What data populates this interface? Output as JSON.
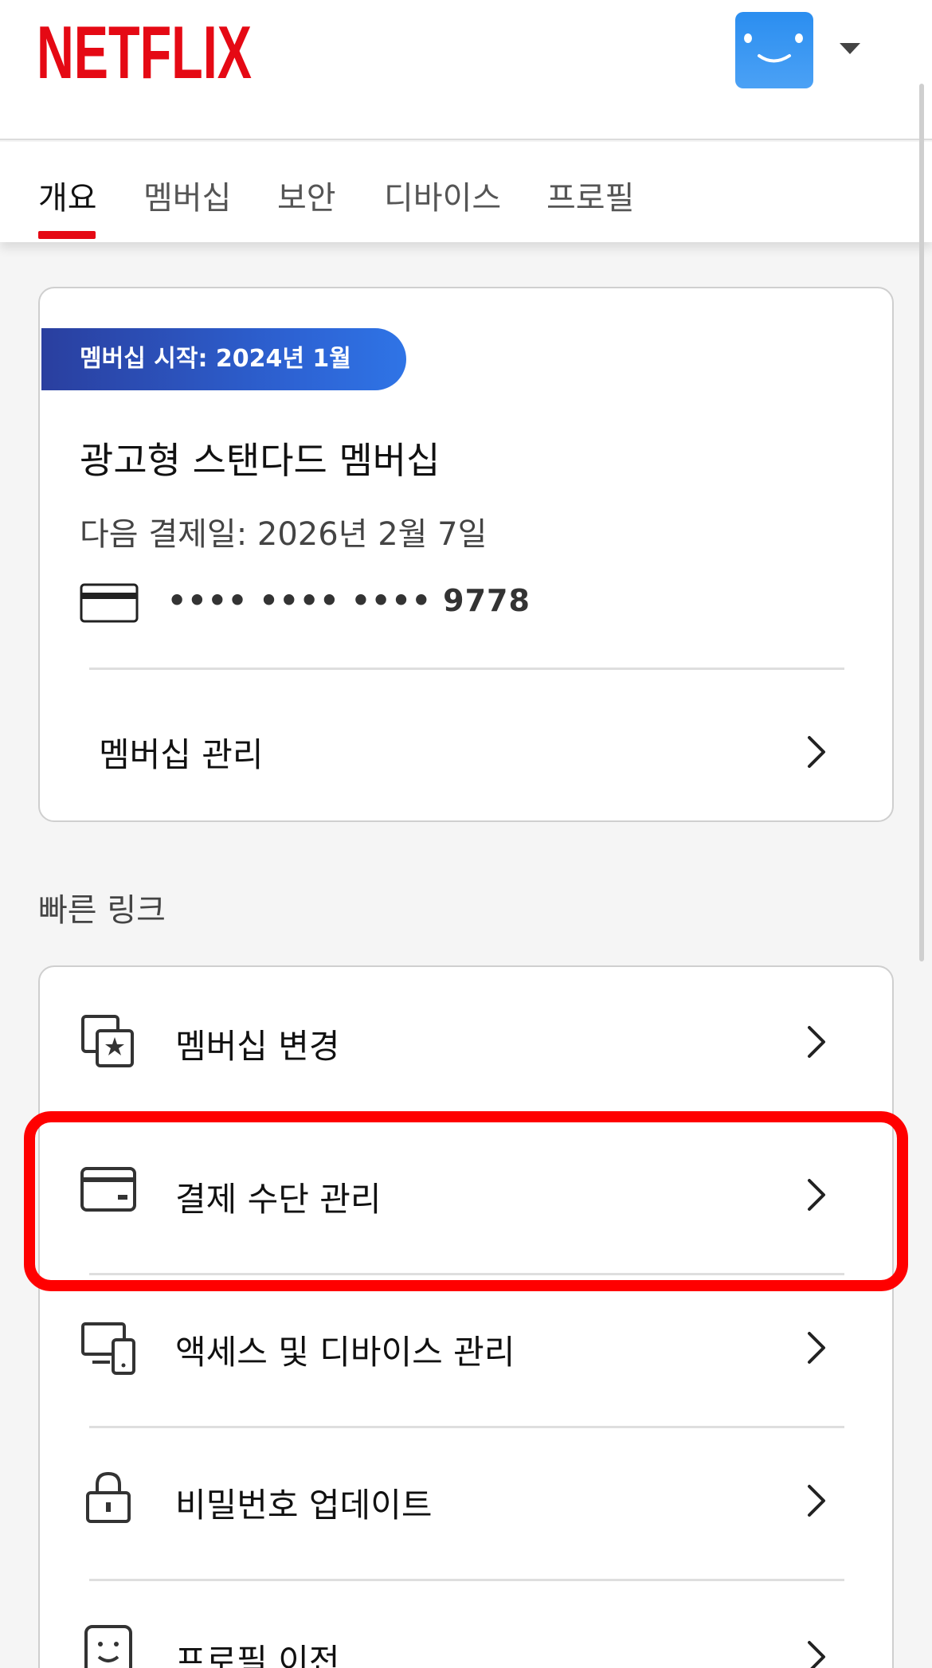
{
  "header": {
    "logo_text": "NETFLIX",
    "brand_color": "#e50914",
    "avatar_color": "#2f8ff0",
    "profile_menu_icon": "caret-down-icon"
  },
  "tabs": [
    {
      "label": "개요",
      "active": true
    },
    {
      "label": "멤버십",
      "active": false
    },
    {
      "label": "보안",
      "active": false
    },
    {
      "label": "디바이스",
      "active": false
    },
    {
      "label": "프로필",
      "active": false
    }
  ],
  "membership": {
    "since_badge": "멤버십 시작: 2024년 1월",
    "plan_name": "광고형 스탠다드 멤버십",
    "next_billing": "다음 결제일: 2026년 2월 7일",
    "card_number": "•••• •••• •••• 9778",
    "manage_label": "멤버십 관리"
  },
  "quick_links": {
    "title": "빠른 링크",
    "items": [
      {
        "label": "멤버십 변경",
        "icon": "change-plan-icon"
      },
      {
        "label": "결제 수단 관리",
        "icon": "payment-card-icon"
      },
      {
        "label": "액세스 및 디바이스 관리",
        "icon": "devices-icon"
      },
      {
        "label": "비밀번호 업데이트",
        "icon": "lock-icon"
      },
      {
        "label": "프로필 이전",
        "icon": "profile-transfer-icon"
      }
    ]
  },
  "annotation": {
    "highlight_color": "#ff0000",
    "highlighted_item": "결제 수단 관리"
  }
}
